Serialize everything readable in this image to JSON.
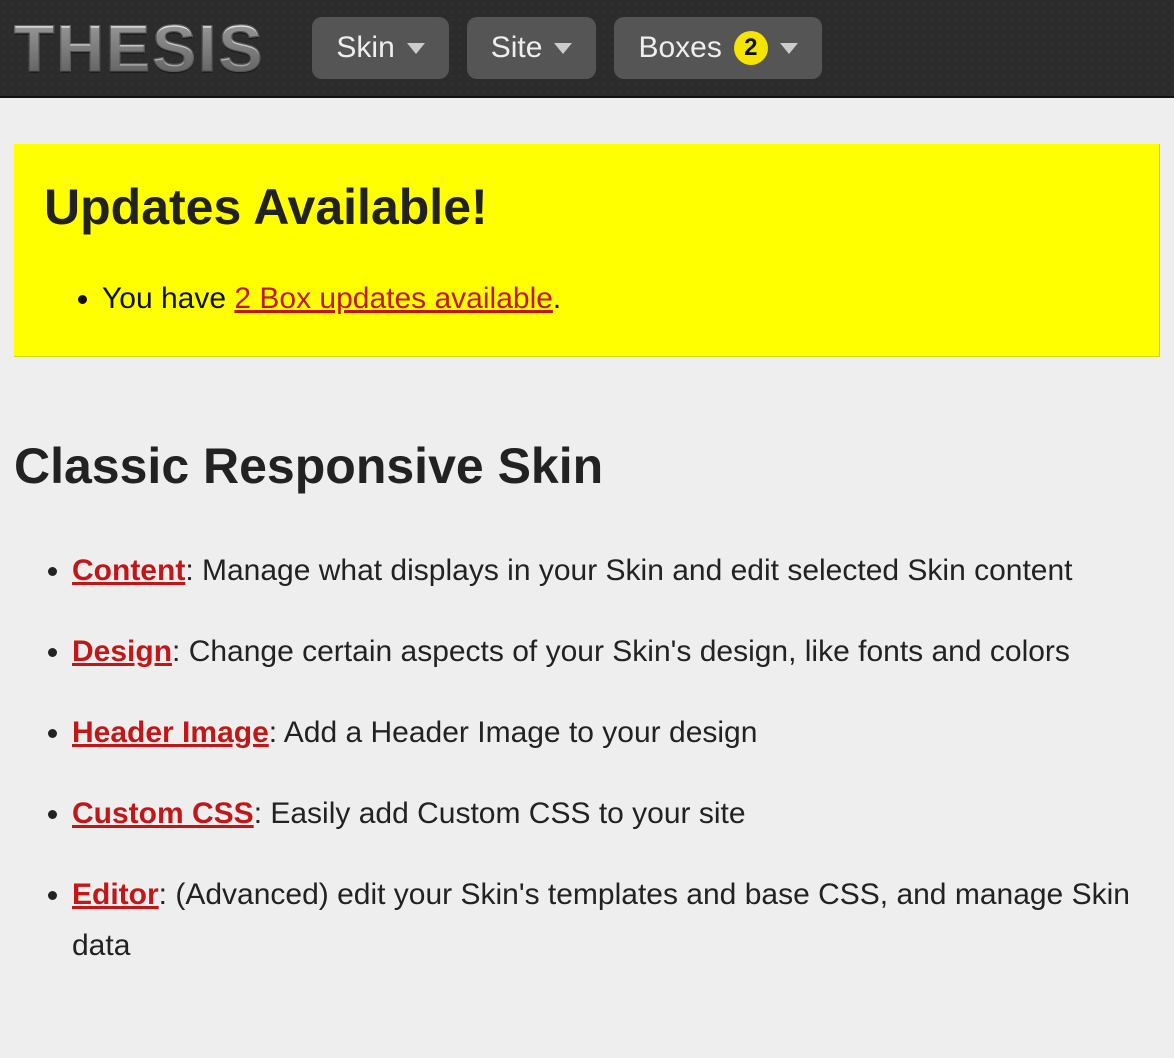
{
  "header": {
    "logo": "THESIS",
    "nav": [
      {
        "label": "Skin",
        "badge": null
      },
      {
        "label": "Site",
        "badge": null
      },
      {
        "label": "Boxes",
        "badge": "2"
      }
    ]
  },
  "alert": {
    "title": "Updates Available!",
    "item_prefix": "You have ",
    "item_link": "2 Box updates available",
    "item_suffix": "."
  },
  "section": {
    "title": "Classic Responsive Skin",
    "items": [
      {
        "link": "Content",
        "desc": ": Manage what displays in your Skin and edit selected Skin content"
      },
      {
        "link": "Design",
        "desc": ": Change certain aspects of your Skin's design, like fonts and colors"
      },
      {
        "link": "Header Image",
        "desc": ": Add a Header Image to your design"
      },
      {
        "link": "Custom CSS",
        "desc": ": Easily add Custom CSS to your site"
      },
      {
        "link": "Editor",
        "desc": ": (Advanced) edit your Skin's templates and base CSS, and manage Skin data"
      }
    ]
  }
}
